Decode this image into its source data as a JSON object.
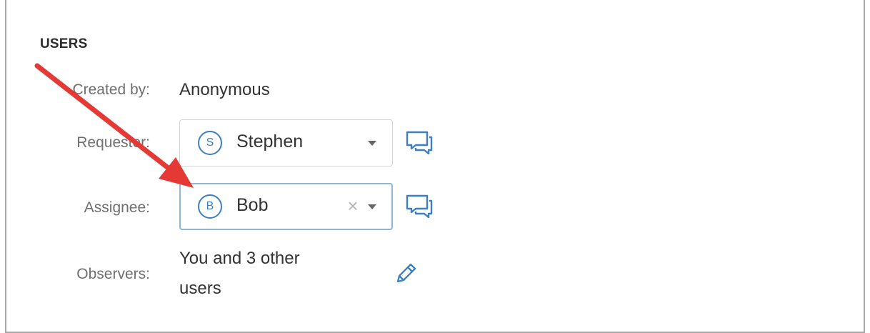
{
  "section": {
    "title": "USERS"
  },
  "fields": {
    "created_by": {
      "label": "Created by:",
      "value": "Anonymous"
    },
    "requester": {
      "label": "Requester:",
      "avatar_initial": "S",
      "value": "Stephen",
      "icon": "chat-icon"
    },
    "assignee": {
      "label": "Assignee:",
      "avatar_initial": "B",
      "value": "Bob",
      "clear_symbol": "×",
      "icon": "chat-icon"
    },
    "observers": {
      "label": "Observers:",
      "line1": "You and 3 other",
      "line2": "users",
      "icon": "pencil-icon"
    }
  },
  "colors": {
    "accent": "#3d7fc2",
    "annotation_arrow": "#e53935",
    "focus_border": "#8fb6d8"
  }
}
